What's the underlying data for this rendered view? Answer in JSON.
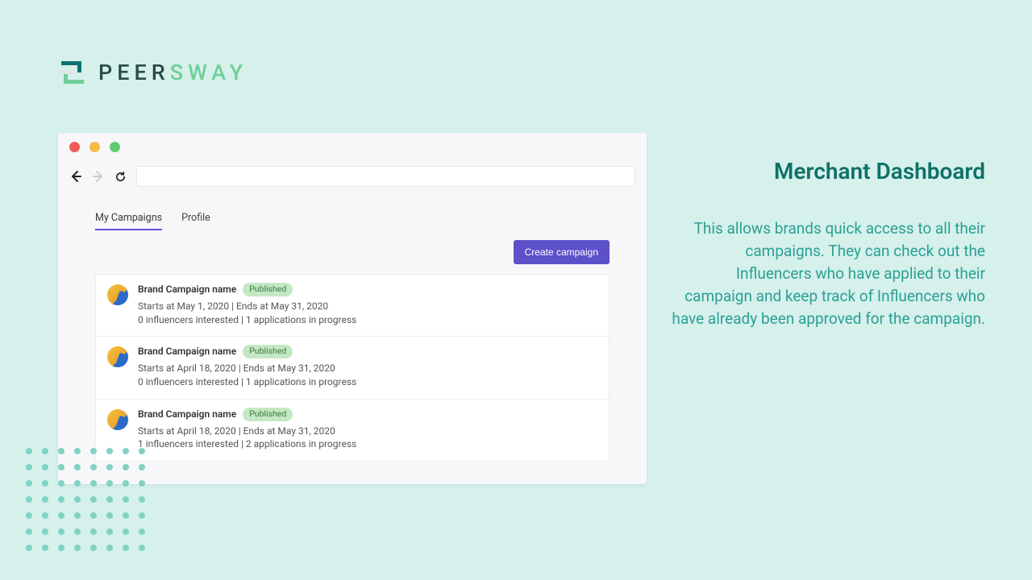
{
  "logo": {
    "text_pre": "PEER",
    "text_post": "SWAY"
  },
  "headline": "Merchant Dashboard",
  "description": "This allows brands quick access to all their campaigns. They can check out the Influencers who have applied to their campaign and keep track of Influencers who have already been approved for the campaign.",
  "browser": {
    "tabs": {
      "my_campaigns": "My Campaigns",
      "profile": "Profile"
    },
    "create_button": "Create campaign",
    "campaigns": [
      {
        "name": "Brand Campaign name",
        "status": "Published",
        "dates": "Starts at May 1, 2020 | Ends at May 31, 2020",
        "stats": "0 influencers interested | 1 applications in progress"
      },
      {
        "name": "Brand Campaign name",
        "status": "Published",
        "dates": "Starts at April 18, 2020 | Ends at May 31, 2020",
        "stats": "0 influencers interested | 1 applications in progress"
      },
      {
        "name": "Brand Campaign name",
        "status": "Published",
        "dates": "Starts at April 18, 2020 | Ends at May 31, 2020",
        "stats": "1 influencers interested | 2 applications in progress"
      }
    ]
  }
}
